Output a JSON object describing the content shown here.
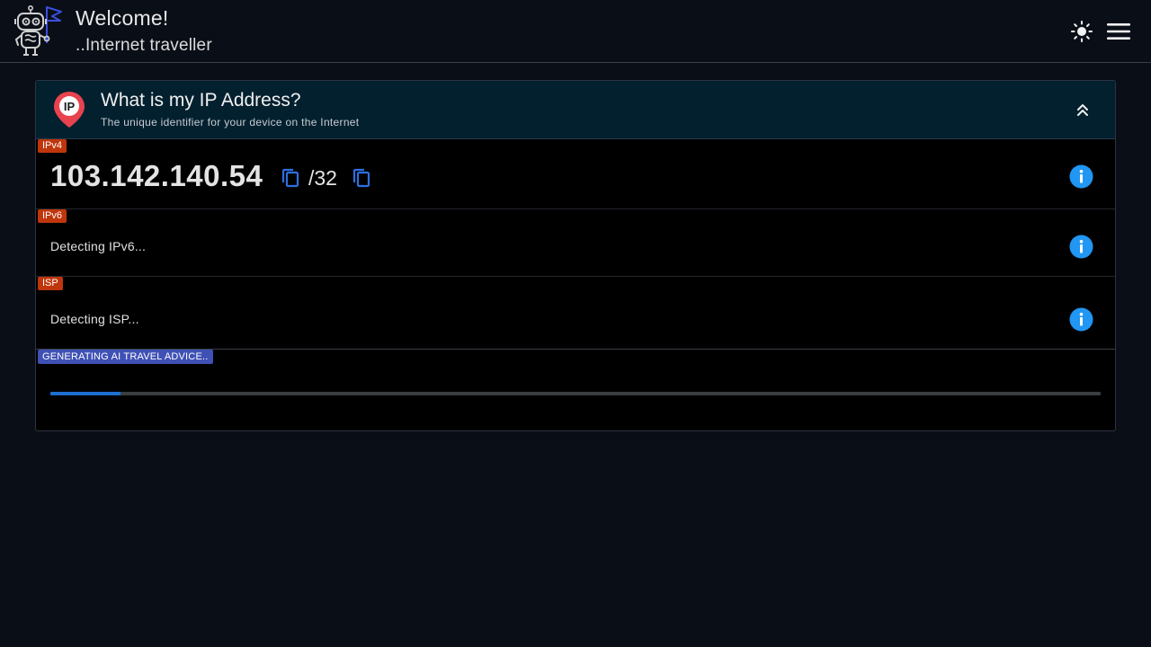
{
  "header": {
    "title": "Welcome!",
    "subtitle": "..Internet traveller",
    "logo_icon": "robot-with-flag-icon",
    "theme_icon": "sun-icon",
    "menu_icon": "hamburger-menu-icon"
  },
  "card": {
    "title": "What is my IP Address?",
    "subtitle": "The unique identifier for your device on the Internet",
    "pin_label": "IP",
    "collapse_icon": "double-chevron-up-icon"
  },
  "ipv4": {
    "badge": "IPv4",
    "address": "103.142.140.54",
    "prefix": "/32"
  },
  "ipv6": {
    "badge": "IPv6",
    "status": "Detecting IPv6..."
  },
  "isp": {
    "badge": "ISP",
    "status": "Detecting ISP..."
  },
  "ai": {
    "badge": "GENERATING AI TRAVEL ADVICE..",
    "progress": 0.067
  },
  "colors": {
    "background": "#0a0e17",
    "card_header": "#03202f",
    "badge_orange": "#bf360c",
    "badge_indigo": "#3f51b5",
    "info_blue": "#2196f3",
    "copy_blue": "#2f6fe0",
    "progress_blue": "#1e6fd0",
    "pin_red": "#e8434f"
  }
}
